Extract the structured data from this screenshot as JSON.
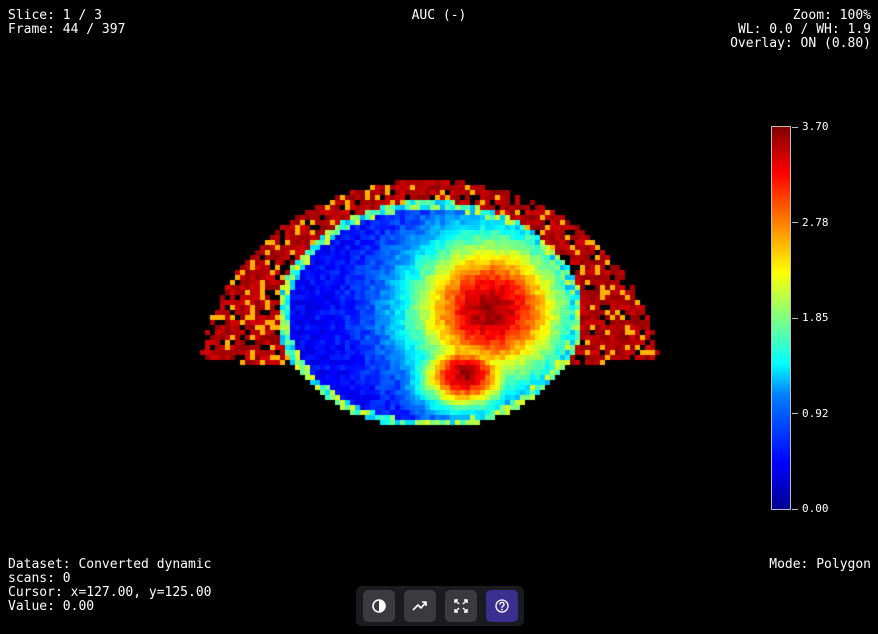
{
  "info": {
    "slice": "Slice: 1 / 3",
    "frame": "Frame: 44 / 397",
    "title": "AUC (-)",
    "zoom": "Zoom: 100%",
    "window": "WL: 0.0 / WH: 1.9",
    "overlay": "Overlay: ON (0.80)",
    "dataset_line1": "Dataset: Converted dynamic",
    "dataset_line2": "scans: 0",
    "cursor": "Cursor: x=127.00, y=125.00",
    "value": "Value: 0.00",
    "mode": "Mode: Polygon"
  },
  "colorbar": {
    "labels": [
      "3.70",
      "2.78",
      "1.85",
      "0.92",
      "0.00"
    ],
    "colormap": "jet",
    "min_color": "#00008f",
    "max_color": "#800000"
  },
  "toolbar": {
    "buttons": [
      {
        "name": "contrast-icon",
        "active": false
      },
      {
        "name": "trend-icon",
        "active": false
      },
      {
        "name": "fullscreen-icon",
        "active": false
      },
      {
        "name": "help-icon",
        "active": true
      }
    ],
    "accent": "#3b2f8f"
  }
}
